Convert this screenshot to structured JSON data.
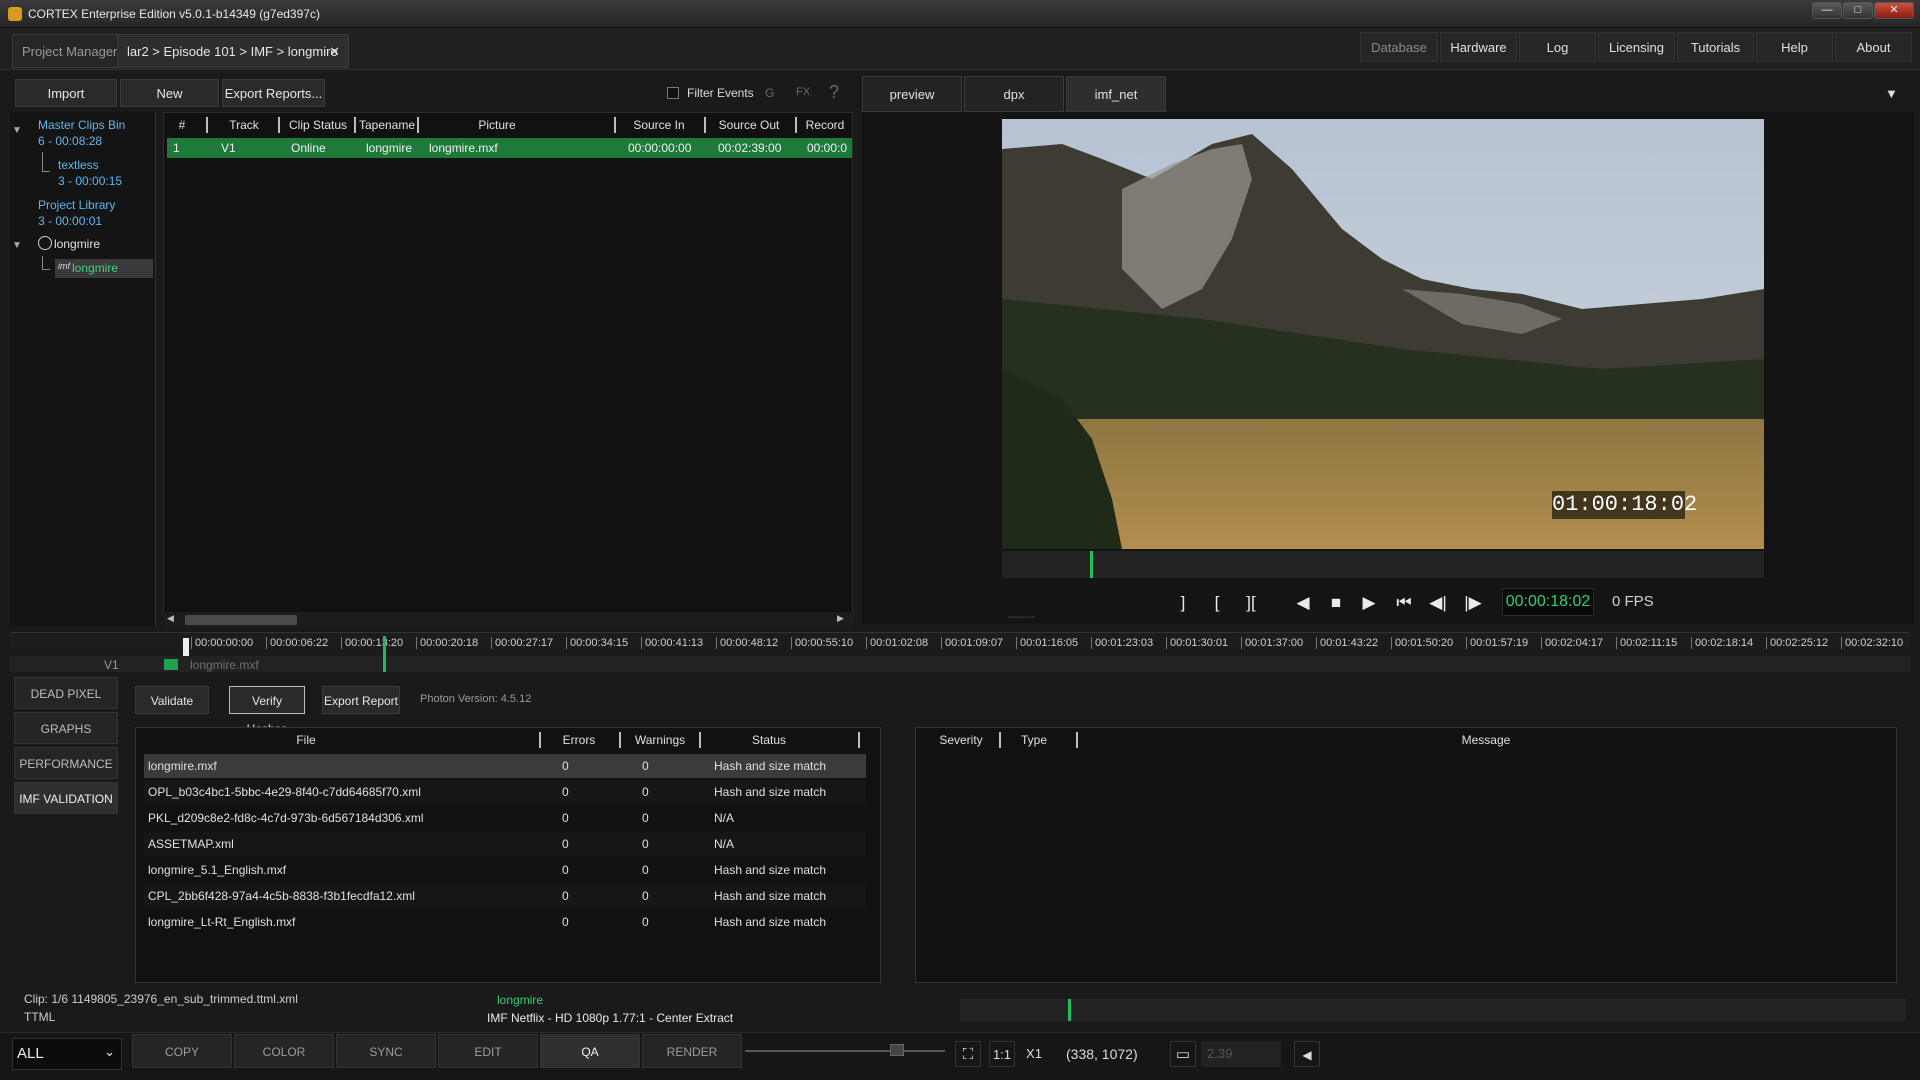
{
  "window": {
    "title": "CORTEX Enterprise Edition v5.0.1-b14349 (g7ed397c)",
    "min": "—",
    "max": "□",
    "close": "✕"
  },
  "tabs": {
    "project_manager": "Project Manager",
    "active": "lar2 > Episode 101 > IMF > longmire",
    "close": "✕"
  },
  "topnav": [
    "Database",
    "Hardware",
    "Log",
    "Licensing",
    "Tutorials",
    "Help",
    "About"
  ],
  "toolbar": {
    "import": "Import",
    "new": "New",
    "export": "Export Reports...",
    "filter": "Filter Events",
    "g": "G",
    "fx": "FX",
    "help": "?"
  },
  "bins": {
    "master": "Master Clips Bin",
    "master_count": "6 - 00:08:28",
    "textless": "textless",
    "textless_count": "3 - 00:00:15",
    "library": "Project Library",
    "library_count": "3 - 00:00:01",
    "group": "longmire",
    "imf_tag": "imf",
    "imf_child": "longmire"
  },
  "clip_table": {
    "headers": [
      "#",
      "Track",
      "Clip Status",
      "Tapename",
      "Picture",
      "Source In",
      "Source Out",
      "Record"
    ],
    "row": [
      "1",
      "V1",
      "Online",
      "longmire",
      "longmire.mxf",
      "00:00:00:00",
      "00:02:39:00",
      "00:00:0"
    ]
  },
  "viewer": {
    "tabs": [
      "preview",
      "dpx",
      "imf_net"
    ],
    "menu": "▼",
    "timecode_overlay": "01:00:18:02",
    "timecode": "00:00:18:02",
    "fps": "0 FPS",
    "dots": "--------"
  },
  "controls": [
    "]",
    "[",
    "][",
    "◀",
    "■",
    "▶",
    "⏮",
    "◀|",
    "|▶"
  ],
  "timeline": {
    "track": "V1",
    "clip": "longmire.mxf",
    "ticks": [
      "00:00:00:00",
      "00:00:06:22",
      "00:00:13:20",
      "00:00:20:18",
      "00:00:27:17",
      "00:00:34:15",
      "00:00:41:13",
      "00:00:48:12",
      "00:00:55:10",
      "00:01:02:08",
      "00:01:09:07",
      "00:01:16:05",
      "00:01:23:03",
      "00:01:30:01",
      "00:01:37:00",
      "00:01:43:22",
      "00:01:50:20",
      "00:01:57:19",
      "00:02:04:17",
      "00:02:11:15",
      "00:02:18:14",
      "00:02:25:12",
      "00:02:32:10"
    ]
  },
  "qa": {
    "sidebar": [
      "DEAD PIXEL",
      "GRAPHS",
      "PERFORMANCE",
      "IMF VALIDATION"
    ],
    "buttons": {
      "validate": "Validate",
      "verify": "Verify Hashes",
      "export": "Export Report"
    },
    "photon": "Photon Version: 4.5.12",
    "file_headers": [
      "File",
      "Errors",
      "Warnings",
      "Status"
    ],
    "files": [
      {
        "file": "longmire.mxf",
        "errors": "0",
        "warnings": "0",
        "status": "Hash and size match"
      },
      {
        "file": "OPL_b03c4bc1-5bbc-4e29-8f40-c7dd64685f70.xml",
        "errors": "0",
        "warnings": "0",
        "status": "Hash and size match"
      },
      {
        "file": "PKL_d209c8e2-fd8c-4c7d-973b-6d567184d306.xml",
        "errors": "0",
        "warnings": "0",
        "status": "N/A"
      },
      {
        "file": "ASSETMAP.xml",
        "errors": "0",
        "warnings": "0",
        "status": "N/A"
      },
      {
        "file": "longmire_5.1_English.mxf",
        "errors": "0",
        "warnings": "0",
        "status": "Hash and size match"
      },
      {
        "file": "CPL_2bb6f428-97a4-4c5b-8838-f3b1fecdfa12.xml",
        "errors": "0",
        "warnings": "0",
        "status": "Hash and size match"
      },
      {
        "file": "longmire_Lt-Rt_English.mxf",
        "errors": "0",
        "warnings": "0",
        "status": "Hash and size match"
      }
    ],
    "msg_headers": [
      "Severity",
      "Type",
      "Message"
    ]
  },
  "status": {
    "clip": "Clip: 1/6   1149805_23976_en_sub_trimmed.ttml.xml",
    "ttml": "TTML",
    "center_green": "longmire",
    "center_white": "IMF Netflix - HD 1080p 1.77:1 - Center Extract"
  },
  "bottom": {
    "filter": "ALL",
    "chev": "⌄",
    "modes": [
      "COPY",
      "COLOR",
      "SYNC",
      "EDIT",
      "QA",
      "RENDER"
    ],
    "one_to_one": "1:1",
    "zoom": "X1",
    "coords": "(338, 1072)",
    "ratio": "2.39",
    "fullscreen": "⛶",
    "aspect_icon": "▭",
    "speaker": "◀"
  }
}
